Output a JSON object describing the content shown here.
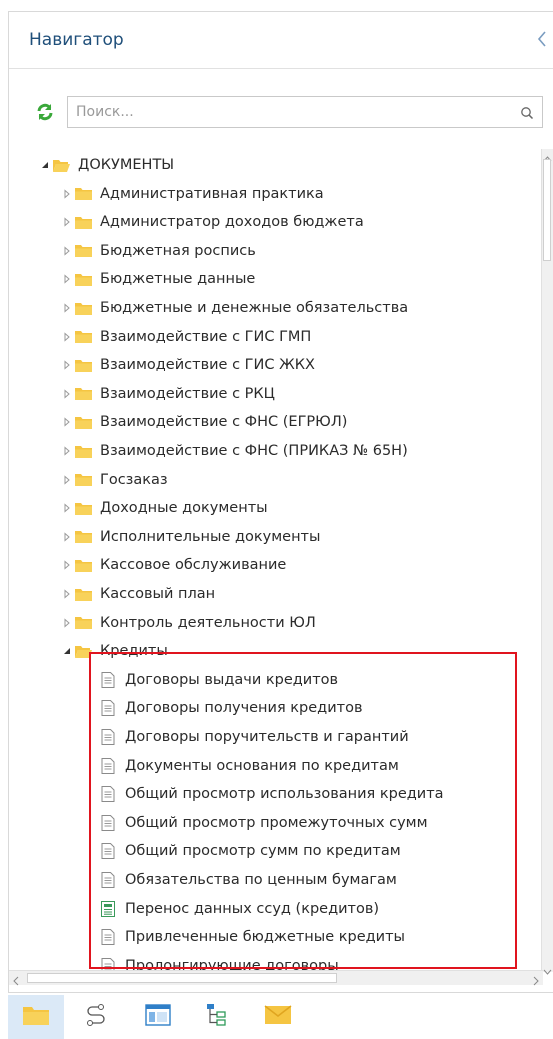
{
  "header": {
    "title": "Навигатор"
  },
  "search": {
    "placeholder": "Поиск..."
  },
  "tree": {
    "root": {
      "label": "ДОКУМЕНТЫ"
    },
    "folders": [
      "Административная практика",
      "Администратор доходов бюджета",
      "Бюджетная роспись",
      "Бюджетные данные",
      "Бюджетные и денежные обязательства",
      "Взаимодействие с ГИС ГМП",
      "Взаимодействие с ГИС ЖКХ",
      "Взаимодействие с РКЦ",
      "Взаимодействие с ФНС (ЕГРЮЛ)",
      "Взаимодействие с ФНС (ПРИКАЗ № 65Н)",
      "Госзаказ",
      "Доходные документы",
      "Исполнительные документы",
      "Кассовое обслуживание",
      "Кассовый план",
      "Контроль деятельности ЮЛ"
    ],
    "expanded_folder": {
      "label": "Кредиты"
    },
    "documents": [
      "Договоры выдачи кредитов",
      "Договоры получения кредитов",
      "Договоры поручительств и гарантий",
      "Документы основания по кредитам",
      "Общий просмотр использования кредита",
      "Общий просмотр промежуточных сумм",
      "Общий просмотр сумм по кредитам",
      "Обязательства по ценным бумагам",
      "Перенос данных ссуд (кредитов)",
      "Привлеченные бюджетные кредиты",
      "Пролонгирующие договоры"
    ]
  },
  "bottom_bar": [
    "folder-icon",
    "route-icon",
    "window-icon",
    "tree-structure-icon",
    "mail-icon"
  ],
  "colors": {
    "title": "#1f4f7a",
    "highlight": "#e0141e",
    "folder": "#f5c542",
    "refresh": "#3aa83a",
    "active_tab": "#dbe9f7"
  }
}
